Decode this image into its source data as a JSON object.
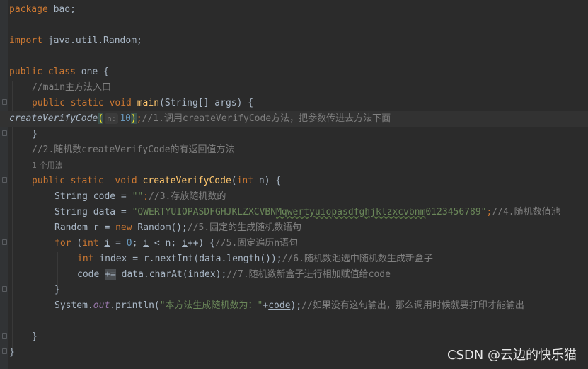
{
  "code": {
    "l1": [
      "package",
      " bao;"
    ],
    "l3": [
      "import",
      " java.util.Random;"
    ],
    "l5": [
      "public class",
      " one {"
    ],
    "l6": "//main主方法入口",
    "l7": [
      "public static void",
      "main",
      "(String[] args) {"
    ],
    "l8": [
      "createVerifyCode",
      "(",
      "n:",
      "10",
      ")",
      ";",
      "//1.调用createVerifyCode方法，把参数传进去方法下面"
    ],
    "l9": "}",
    "l10": "//2.随机数createVerifyCode的有返回值方法",
    "l11": "1 个用法",
    "l12": [
      "public static  void",
      "createVerifyCode",
      "(",
      "int",
      " n) {"
    ],
    "l13": [
      "String ",
      "code",
      " = ",
      "\"\"",
      ";",
      "//3.存放随机数的"
    ],
    "l14": [
      "String data = ",
      "\"QWERTYUIOPASDFGHJKLZXCVBN",
      "Mqwertyuiopasdfghjklzxcvbnm",
      "0123456789\"",
      ";",
      "//4.随机数值池"
    ],
    "l15": [
      "Random r = ",
      "new",
      " Random();",
      "//5.固定的生成随机数语句"
    ],
    "l16": [
      "for",
      " (",
      "int",
      " ",
      "i",
      " = ",
      "0",
      "; ",
      "i",
      " < n; ",
      "i",
      "++) {",
      "//5.固定遍历n语句"
    ],
    "l17": [
      "int",
      " index = r.nextInt(data.length());",
      "//6.随机数池选中随机数生成新盒子"
    ],
    "l18": [
      "code",
      " ",
      "+=",
      " data.charAt(index);",
      "//7.随机数新盒子进行相加赋值给code"
    ],
    "l19": "}",
    "l20": [
      "System.",
      "out",
      ".println(",
      "\"本方法生成随机数为：\"",
      "+",
      "code",
      ");",
      "//如果没有这句输出，那么调用时候就要打印才能输出"
    ],
    "l22": "}",
    "l23": "}"
  },
  "watermark": "CSDN @云边的快乐猫"
}
